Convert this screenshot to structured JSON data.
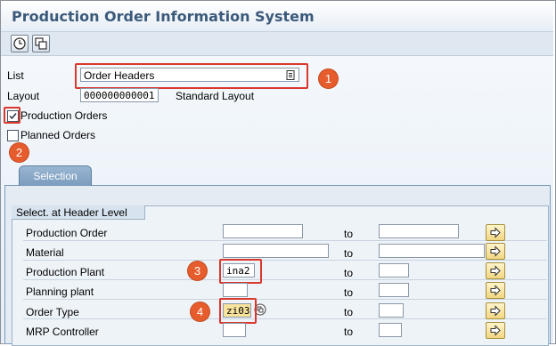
{
  "window": {
    "title": "Production Order Information System"
  },
  "toolbar": {
    "buttons": [
      {
        "icon": "execute-clock-icon"
      },
      {
        "icon": "copy-variant-icon"
      }
    ]
  },
  "header": {
    "list_label": "List",
    "list_value": "Order Headers",
    "layout_label": "Layout",
    "layout_value": "000000000001",
    "layout_desc": "Standard Layout",
    "production_orders": {
      "label": "Production Orders",
      "checked": true
    },
    "planned_orders": {
      "label": "Planned Orders",
      "checked": false
    }
  },
  "tabs": {
    "selection": "Selection"
  },
  "group": {
    "title": "Select. at Header Level"
  },
  "rows": [
    {
      "label": "Production Order",
      "from": "",
      "to_label": "to",
      "to": ""
    },
    {
      "label": "Material",
      "from": "",
      "to_label": "to",
      "to": ""
    },
    {
      "label": "Production Plant",
      "from": "ina2",
      "to_label": "to",
      "to": ""
    },
    {
      "label": "Planning plant",
      "from": "",
      "to_label": "to",
      "to": ""
    },
    {
      "label": "Order Type",
      "from": "zi03",
      "to_label": "to",
      "to": ""
    },
    {
      "label": "MRP Controller",
      "from": "",
      "to_label": "to",
      "to": ""
    }
  ],
  "annotations": [
    "1",
    "2",
    "3",
    "4"
  ],
  "colors": {
    "accent_red": "#d9382e",
    "badge_orange": "#e65c2c",
    "title_blue": "#3b5a7a"
  }
}
